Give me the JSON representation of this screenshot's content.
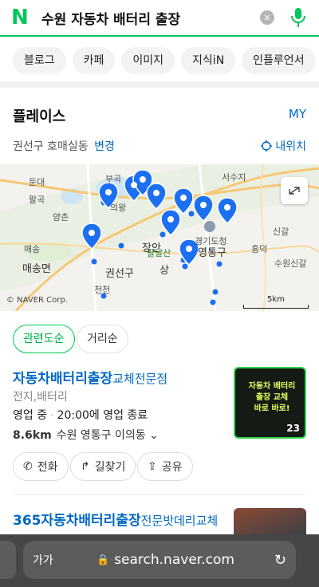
{
  "search": {
    "logo": "N",
    "query": "수원 자동차 배터리 출장",
    "clear_icon": "×"
  },
  "tabs": [
    "블로그",
    "카페",
    "이미지",
    "지식iN",
    "인플루언서"
  ],
  "places": {
    "title": "플레이스",
    "my_link": "MY",
    "location": "권선구 호매실동",
    "change_label": "변경",
    "my_position": "내위치"
  },
  "map": {
    "labels": [
      "부곡",
      "서수지",
      "둔대",
      "팔곡",
      "의왕",
      "양촌",
      "매송",
      "매송면",
      "팔달산",
      "경기도청",
      "영통구",
      "신갈",
      "흥덕",
      "수원신갈",
      "권선구",
      "천천",
      "장안",
      "상"
    ],
    "copyright": "© NAVER Corp.",
    "scale_label": "5km"
  },
  "filters": [
    "관련도순",
    "거리순"
  ],
  "result1": {
    "name_highlight": "자동차배터리출장",
    "name_rest": "교체전문점",
    "category": "전지,배터리",
    "status": "영업 중",
    "closing": "20:00에 영업 종료",
    "distance": "8.6km",
    "address": "수원 영통구 이의동",
    "thumb_lines": [
      "자동차 배터리",
      "출장 교체",
      "바로 바로!"
    ],
    "photo_count": "23",
    "actions": [
      "전화",
      "길찾기",
      "공유"
    ]
  },
  "result2": {
    "name_highlight": "365자동차배터리출장",
    "name_rest": "전문밧데리교체"
  },
  "browser": {
    "text_size": "가가",
    "url": "search.naver.com"
  },
  "colors": {
    "brand": "#03c75a",
    "link": "#0068c3",
    "pin": "#1c6ff0"
  }
}
